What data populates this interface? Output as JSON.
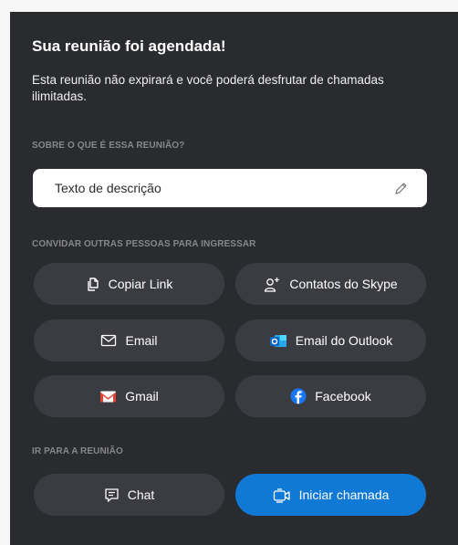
{
  "header": {
    "title": "Sua reunião foi agendada!",
    "subtitle": "Esta reunião não expirará e você poderá desfrutar de chamadas ilimitadas."
  },
  "about": {
    "heading": "SOBRE O QUE É ESSA REUNIÃO?",
    "description": "Texto de descrição",
    "edit_icon": "pencil-icon"
  },
  "invite": {
    "heading": "CONVIDAR OUTRAS PESSOAS PARA INGRESSAR",
    "copy_link": "Copiar Link",
    "skype_contacts": "Contatos do Skype",
    "email": "Email",
    "outlook_email": "Email do Outlook",
    "gmail": "Gmail",
    "facebook": "Facebook"
  },
  "meeting": {
    "heading": "IR PARA A REUNIÃO",
    "chat": "Chat",
    "start_call": "Iniciar chamada"
  },
  "colors": {
    "panel": "#2a2b2f",
    "button": "#3b3c41",
    "primary": "#0f79d5",
    "section_text": "#86878b"
  }
}
